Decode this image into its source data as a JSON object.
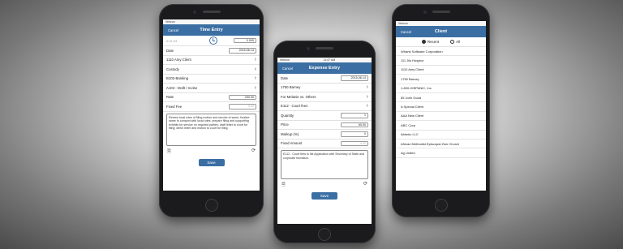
{
  "colors": {
    "accent": "#3b6fa3"
  },
  "phone1": {
    "status": {
      "carrier": "Verizon",
      "time": "",
      "battery": ""
    },
    "nav": {
      "cancel": "Cancel",
      "title": "Time Entry"
    },
    "timer": {
      "elapsed": "0:01:03",
      "value": "0.000"
    },
    "date": {
      "label": "Date",
      "value": "2015-06-14"
    },
    "rows": [
      "1110 Amy Client",
      "Custody",
      "B102-Banking",
      "A103 - Draft / revise"
    ],
    "rate": {
      "label": "Rate",
      "value": "250.00"
    },
    "fixed_fee": {
      "label": "Fixed Fee",
      "placeholder": "0.00"
    },
    "note": "Review local rules of filing motion and service of same; finalize same to comport with local rules; prepare filing and supporting exhibits for service on required parties; draft letter to court for filing; direct letter and motion to court for filing.",
    "save": "Save",
    "icons": [
      "document-icon",
      "sync-icon"
    ]
  },
  "phone2": {
    "status": {
      "carrier": "Verizon",
      "time": "11:47 AM",
      "battery": ""
    },
    "nav": {
      "cancel": "Cancel",
      "title": "Expense Entry"
    },
    "date": {
      "label": "Date",
      "value": "2015-06-14"
    },
    "rows": [
      "1750 Barney",
      "For Melanie vs. Others",
      "E112 - Court fees"
    ],
    "quantity": {
      "label": "Quantity",
      "value": "1"
    },
    "price": {
      "label": "Price",
      "value": "60.00"
    },
    "markup": {
      "label": "Markup (%)",
      "value": "0"
    },
    "fixed_amount": {
      "label": "Fixed Amount",
      "placeholder": "0.00"
    },
    "note": "E112 - Court fees to file Application with Secretary of State and corporate formation.",
    "save": "Save"
  },
  "phone3": {
    "status": {
      "carrier": "Verizon",
      "time": "",
      "battery": ""
    },
    "nav": {
      "cancel": "Cancel",
      "title": "Client"
    },
    "segment": {
      "recent": "Recent",
      "all": "All"
    },
    "clients": [
      "Wharst Software Corporation",
      "111 Jils Hospice",
      "1110 Amy Client",
      "1750 Barney",
      "1-800-HISPANIC, Inc.",
      "65 John Good",
      "A Special Client",
      "AAA New Client",
      "ABC Corp",
      "Abkeko LLC",
      "African Methodist Episcopal Zion Church",
      "Ag United"
    ]
  }
}
